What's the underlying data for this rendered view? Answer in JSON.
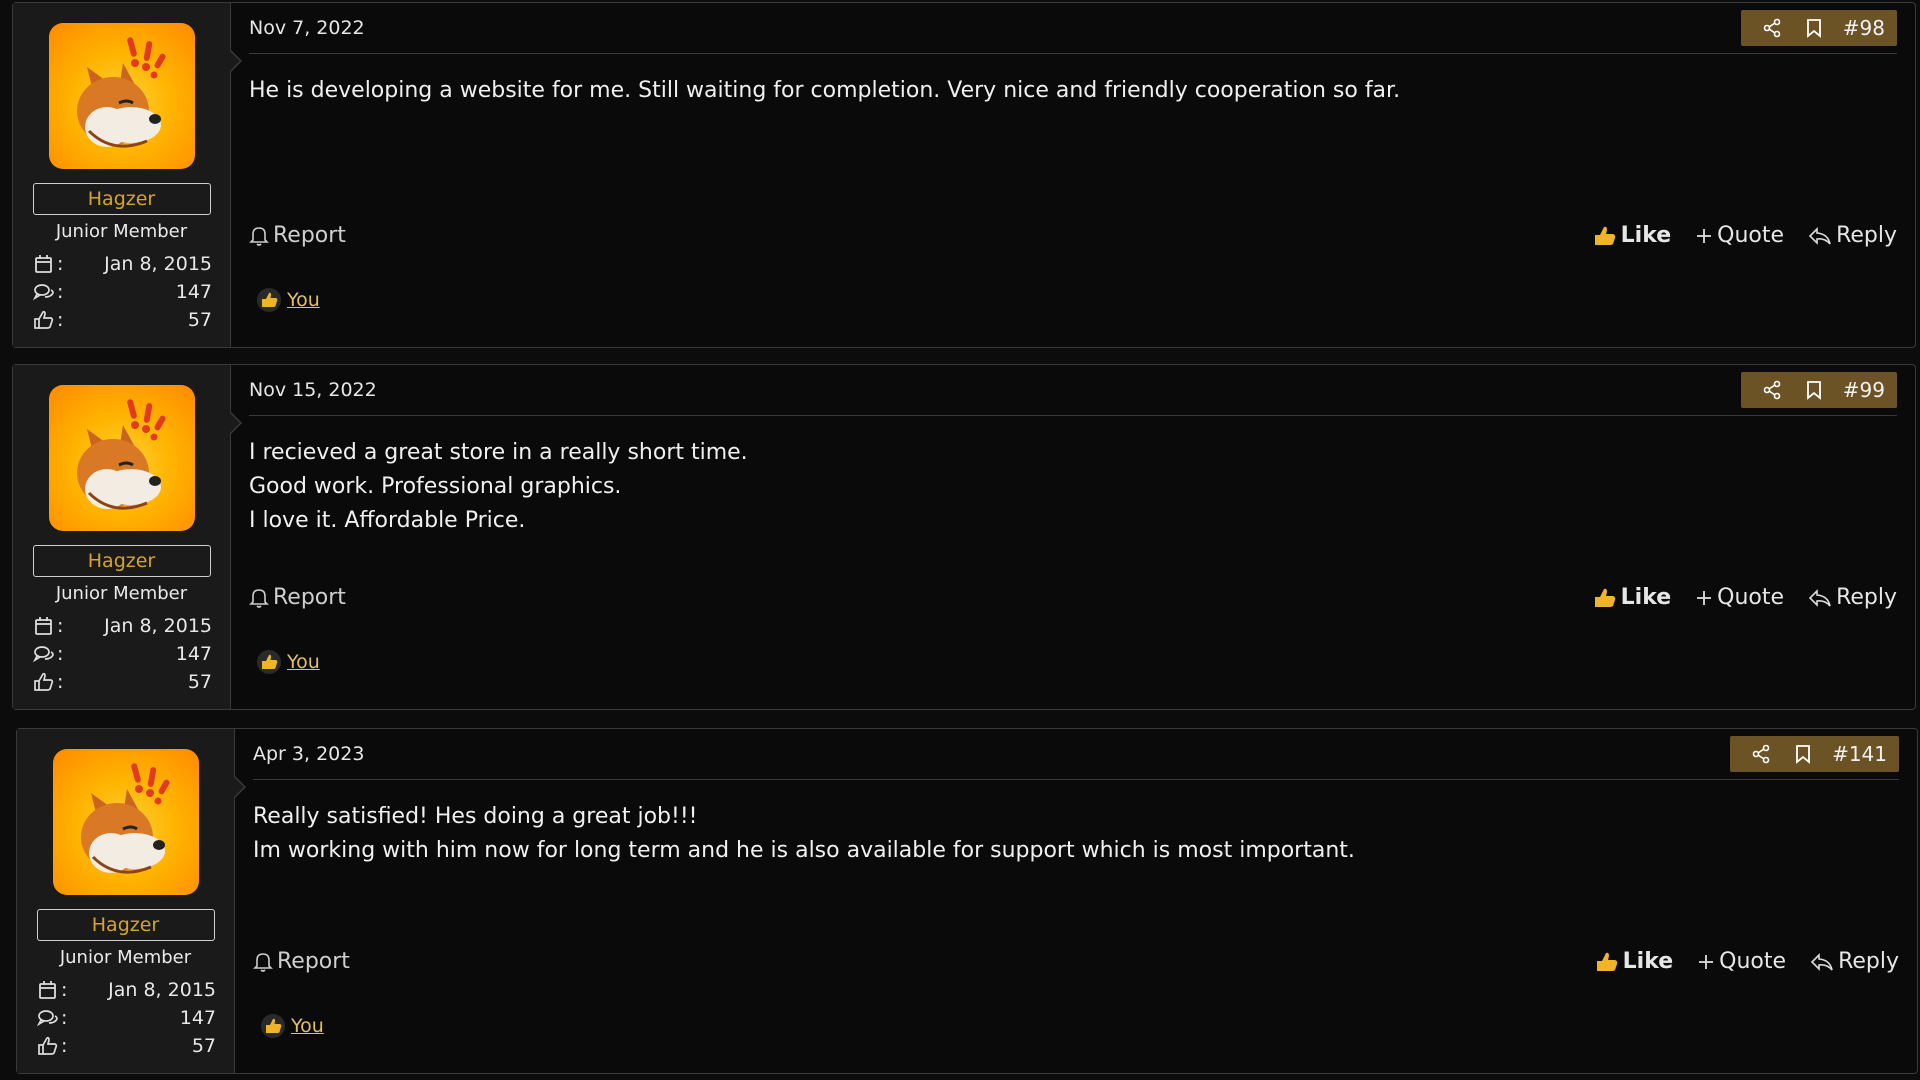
{
  "colors": {
    "accent": "#6b5326",
    "username": "#d6a52a",
    "like": "#f0b428"
  },
  "posts": [
    {
      "date": "Nov 7, 2022",
      "number": "#98",
      "body": [
        "He is developing a website for me. Still waiting for completion. Very nice and friendly cooperation so far."
      ],
      "user": {
        "name": "Hagzer",
        "title": "Junior Member",
        "joined": "Jan 8, 2015",
        "messages": "147",
        "reactions": "57"
      },
      "actions": {
        "report": "Report",
        "like": "Like",
        "quote": "Quote",
        "reply": "Reply"
      },
      "reacted_by": "You"
    },
    {
      "date": "Nov 15, 2022",
      "number": "#99",
      "body": [
        "I recieved a great store in a really short time.",
        "Good work. Professional graphics.",
        "I love it. Affordable Price."
      ],
      "user": {
        "name": "Hagzer",
        "title": "Junior Member",
        "joined": "Jan 8, 2015",
        "messages": "147",
        "reactions": "57"
      },
      "actions": {
        "report": "Report",
        "like": "Like",
        "quote": "Quote",
        "reply": "Reply"
      },
      "reacted_by": "You"
    },
    {
      "date": "Apr 3, 2023",
      "number": "#141",
      "body": [
        "Really satisfied! Hes doing a great job!!!",
        "Im working with him now for long term and he is also available for support which is most important."
      ],
      "user": {
        "name": "Hagzer",
        "title": "Junior Member",
        "joined": "Jan 8, 2015",
        "messages": "147",
        "reactions": "57"
      },
      "actions": {
        "report": "Report",
        "like": "Like",
        "quote": "Quote",
        "reply": "Reply"
      },
      "reacted_by": "You"
    }
  ],
  "icons": {
    "share": "share-icon",
    "bookmark": "bookmark-icon",
    "calendar": "calendar-icon",
    "messages": "messages-icon",
    "thumbs": "thumbs-up-icon",
    "bell": "bell-icon",
    "plus": "plus-icon",
    "reply": "reply-icon"
  }
}
